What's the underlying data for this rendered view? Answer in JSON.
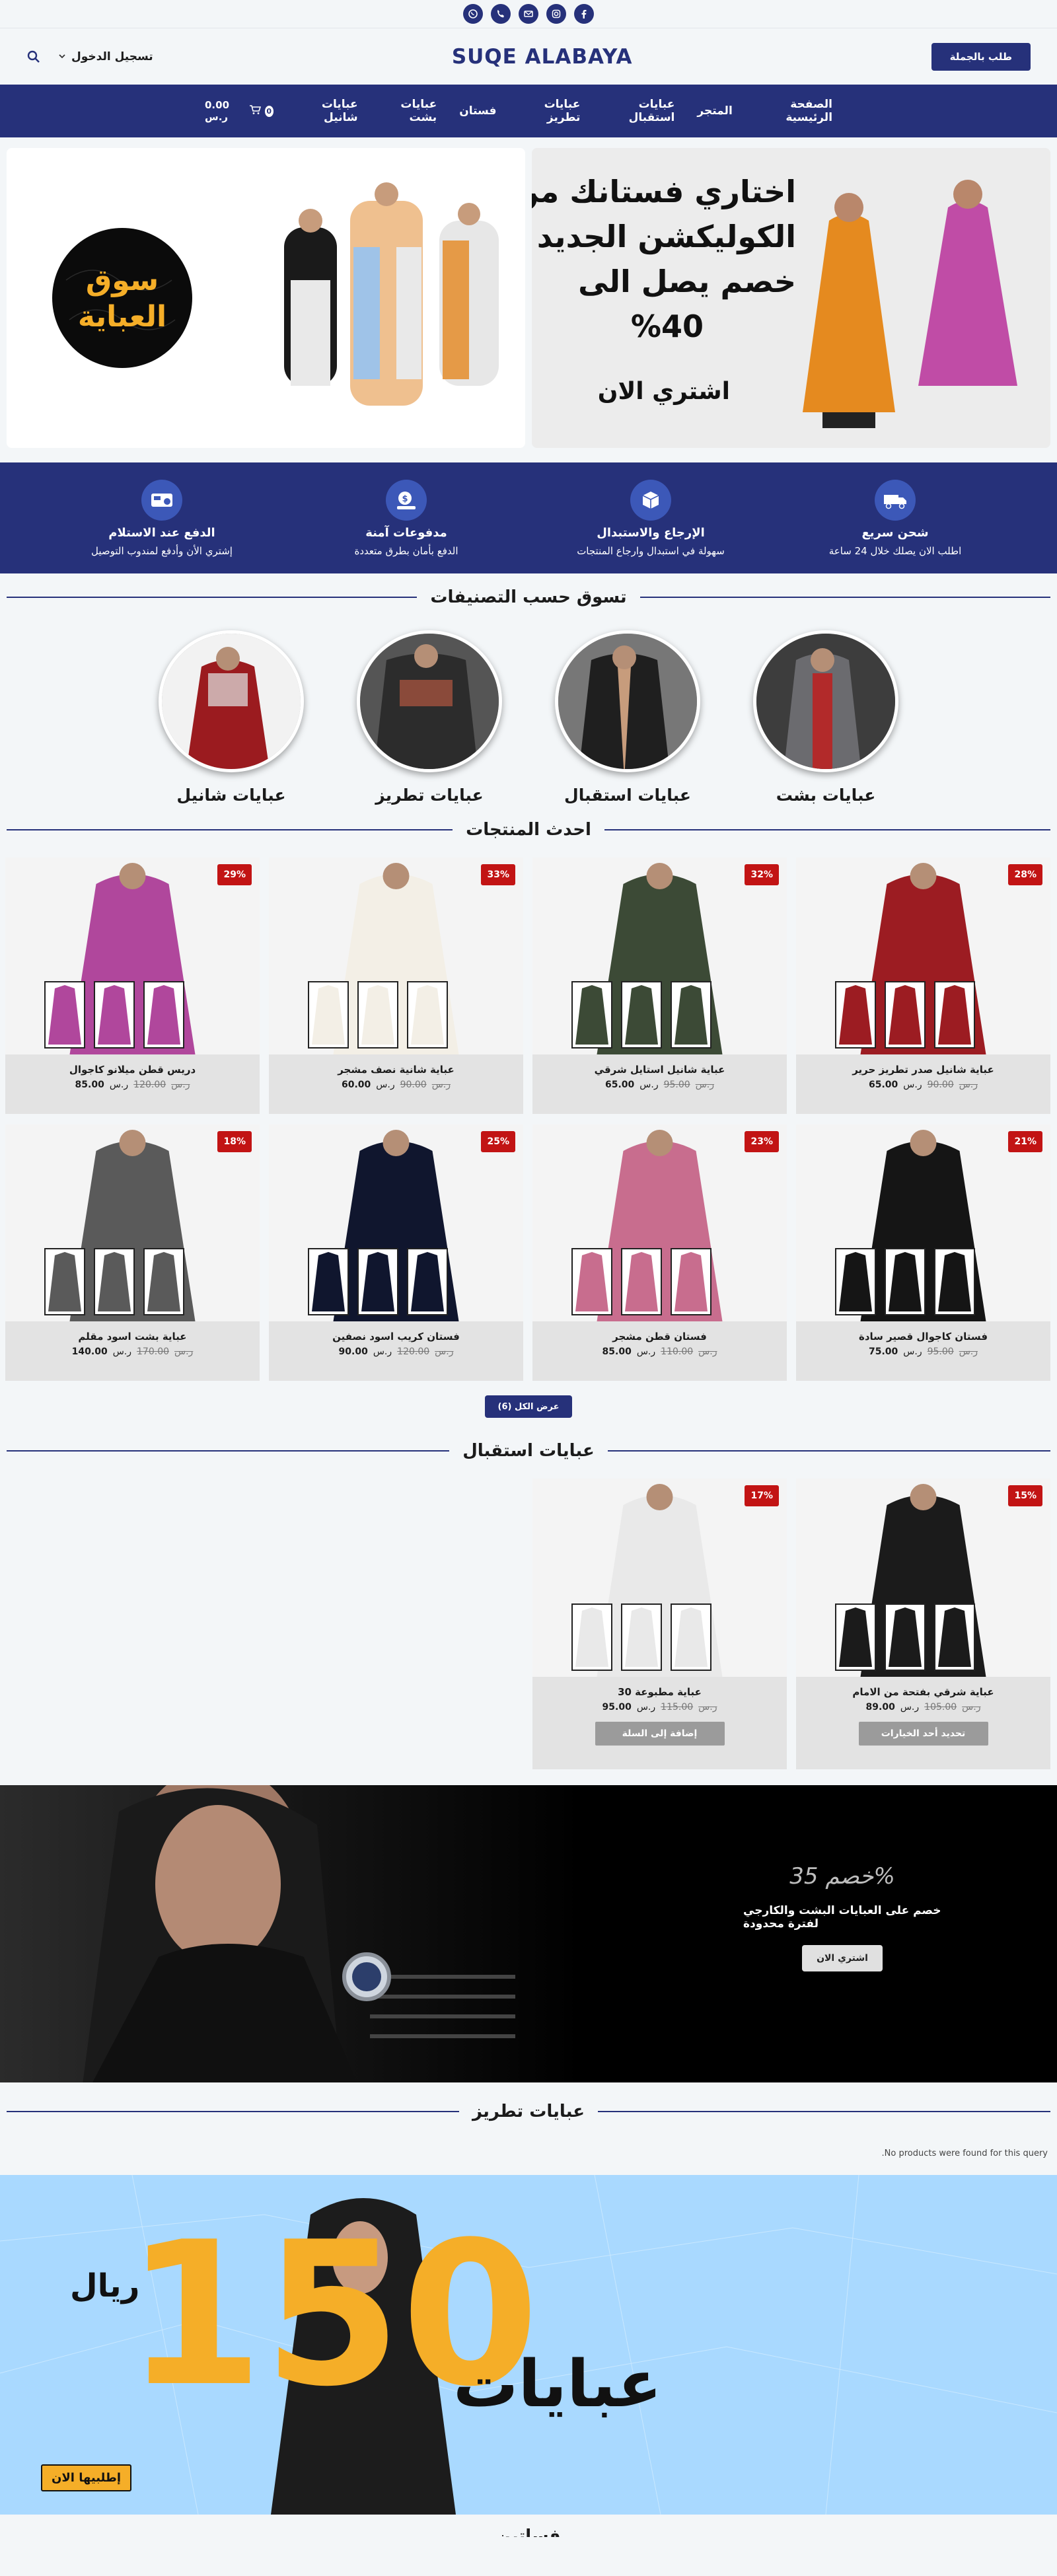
{
  "social": [
    "facebook-icon",
    "instagram-icon",
    "mail-icon",
    "phone-icon",
    "whatsapp-icon"
  ],
  "header": {
    "brand": "SUQE ALABAYA",
    "login_label": "تسجيل الدخول",
    "wholesale_label": "طلب بالجملة"
  },
  "nav": {
    "items": [
      "الصفحة الرئيسية",
      "المتجر",
      "عبايات استقبال",
      "عبايات تطريز",
      "فستان",
      "عبايات بشت",
      "عبايات شانيل"
    ],
    "cart_total": "0.00 ر.س",
    "cart_count": "0"
  },
  "hero": {
    "left_line1": "اختاري فستانك من",
    "left_line2": "الكوليكشن الجديد",
    "left_line3": "خصم يصل الى",
    "left_line4": "%40",
    "left_cta": "اشتري الان",
    "right_logo_line1": "سوق",
    "right_logo_line2": "العباية"
  },
  "features": [
    {
      "icon": "delivery-truck-icon",
      "title": "شحن سريع",
      "sub": "اطلب الان يصلك خلال 24 ساعة"
    },
    {
      "icon": "return-box-icon",
      "title": "الإرجاع والاستبدال",
      "sub": "سهولة في استبدال وارجاع المنتجات"
    },
    {
      "icon": "secure-payment-icon",
      "title": "مدفوعات آمنة",
      "sub": "الدفع بأمان بطرق متعددة"
    },
    {
      "icon": "cash-on-delivery-icon",
      "title": "الدفع عند الاستلام",
      "sub": "إشتري الأن وأدفع لمندوب التوصيل"
    }
  ],
  "sections": {
    "categories_title": "تسوق حسب التصنيفات",
    "latest_title": "احدث المنتجات",
    "reception_title": "عبايات استقبال",
    "embroidery_title": "عبايات تطريز",
    "next_title": "فساتين"
  },
  "categories": [
    {
      "name": "عبايات بشت",
      "color": "#6a6a72"
    },
    {
      "name": "عبايات استقبال",
      "color": "#3a3a3a"
    },
    {
      "name": "عبايات تطريز",
      "color": "#4a4a4a"
    },
    {
      "name": "عبايات شانيل",
      "color": "#9b1b1f"
    }
  ],
  "latest_products": [
    {
      "name": "عباية شانيل صدر تطريز حرير",
      "old": "90.00",
      "new": "65.00",
      "currency": "ر.س",
      "badge": "28%",
      "color": "#9c1c22"
    },
    {
      "name": "عباية شانيل استايل شرقي",
      "old": "95.00",
      "new": "65.00",
      "currency": "ر.س",
      "badge": "32%",
      "color": "#3c4a36"
    },
    {
      "name": "عباية شانية نصف مشجر",
      "old": "90.00",
      "new": "60.00",
      "currency": "ر.س",
      "badge": "33%",
      "color": "#f3efe6"
    },
    {
      "name": "دريس قطن ميلانو كاجوال",
      "old": "120.00",
      "new": "85.00",
      "currency": "ر.س",
      "badge": "29%",
      "color": "#b0479c"
    },
    {
      "name": "فستان كاجوال قصير سادة",
      "old": "95.00",
      "new": "75.00",
      "currency": "ر.س",
      "badge": "21%",
      "color": "#151515"
    },
    {
      "name": "فستان قطن مشجر",
      "old": "110.00",
      "new": "85.00",
      "currency": "ر.س",
      "badge": "23%",
      "color": "#c86d8e"
    },
    {
      "name": "فستان كريب اسود نصفين",
      "old": "120.00",
      "new": "90.00",
      "currency": "ر.س",
      "badge": "25%",
      "color": "#10162e"
    },
    {
      "name": "عباية بشت اسود مقلم",
      "old": "170.00",
      "new": "140.00",
      "currency": "ر.س",
      "badge": "18%",
      "color": "#5a5a5a"
    }
  ],
  "view_all_label": "عرض الكل (6)",
  "reception_products": [
    {
      "name": "عباية شرقي بفتحة من الامام",
      "old": "105.00",
      "new": "89.00",
      "currency": "ر.س",
      "badge": "15%",
      "button": "تحديد أحد الخيارات",
      "color": "#1b1b1b"
    },
    {
      "name": "عباية مطبوعة 30",
      "old": "115.00",
      "new": "95.00",
      "currency": "ر.س",
      "badge": "17%",
      "button": "إضافة إلى السلة",
      "color": "#e9e9e9"
    }
  ],
  "promo": {
    "headline": "خصم 35%",
    "subtitle": "خصم على العبايات البشت والكارجي لفترة محدودة",
    "button": "اشتري الان"
  },
  "embroidery_empty": "No products were found for this query.",
  "banner2": {
    "number": "150",
    "currency": "ريال",
    "word": "عبايات",
    "button": "إطلبيها الان"
  },
  "colors": {
    "primary": "#26317a",
    "badge": "#c21414",
    "accent": "#f5ae28"
  }
}
